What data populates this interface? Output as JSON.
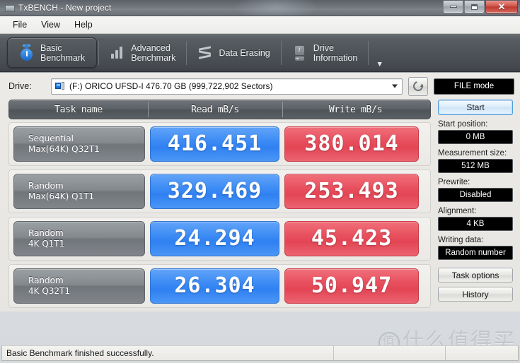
{
  "window": {
    "title": "TxBENCH - New project",
    "app_icon": "monitor-icon",
    "minimize_label": "–",
    "maximize_label": "❐",
    "close_label": "✕"
  },
  "menu": {
    "items": [
      {
        "label": "File"
      },
      {
        "label": "View"
      },
      {
        "label": "Help"
      }
    ]
  },
  "tabs": [
    {
      "label_line1": "Basic",
      "label_line2": "Benchmark",
      "icon": "stopwatch-icon",
      "selected": true
    },
    {
      "label_line1": "Advanced",
      "label_line2": "Benchmark",
      "icon": "bar-chart-icon",
      "selected": false
    },
    {
      "label_line1": "Data Erasing",
      "label_line2": "",
      "icon": "shredder-icon",
      "selected": false
    },
    {
      "label_line1": "Drive",
      "label_line2": "Information",
      "icon": "drive-info-icon",
      "selected": false
    }
  ],
  "tab_overflow_icon": "chevron-down-icon",
  "drive": {
    "label": "Drive:",
    "selected": "(F:) ORICO UFSD-I  476.70 GB (999,722,902 Sectors)",
    "icon": "drive-icon",
    "dropdown_icon": "chevron-down-icon",
    "refresh_icon": "refresh-icon",
    "mode_indicator": "FILE mode"
  },
  "table": {
    "headers": [
      "Task name",
      "Read mB/s",
      "Write mB/s"
    ],
    "rows": [
      {
        "name_line1": "Sequential",
        "name_line2": "Max(64K) Q32T1",
        "read": "416.451",
        "write": "380.014"
      },
      {
        "name_line1": "Random",
        "name_line2": "Max(64K) Q1T1",
        "read": "329.469",
        "write": "253.493"
      },
      {
        "name_line1": "Random",
        "name_line2": "4K Q1T1",
        "read": "24.294",
        "write": "45.423"
      },
      {
        "name_line1": "Random",
        "name_line2": "4K Q32T1",
        "read": "26.304",
        "write": "50.947"
      }
    ]
  },
  "chart_data": {
    "type": "bar",
    "title": "TxBENCH Basic Benchmark Results",
    "categories": [
      "Sequential Max(64K) Q32T1",
      "Random Max(64K) Q1T1",
      "Random 4K Q1T1",
      "Random 4K Q32T1"
    ],
    "series": [
      {
        "name": "Read mB/s",
        "values": [
          416.451,
          329.469,
          24.294,
          26.304
        ],
        "color": "#3d8cf5"
      },
      {
        "name": "Write mB/s",
        "values": [
          380.014,
          253.493,
          45.423,
          50.947
        ],
        "color": "#e8505e"
      }
    ],
    "xlabel": "Task name",
    "ylabel": "mB/s",
    "legend": [
      "Read mB/s",
      "Write mB/s"
    ]
  },
  "side": {
    "start_button": "Start",
    "fields": [
      {
        "label": "Start position:",
        "value": "0 MB"
      },
      {
        "label": "Measurement size:",
        "value": "512 MB"
      },
      {
        "label": "Prewrite:",
        "value": "Disabled"
      },
      {
        "label": "Alignment:",
        "value": "4 KB"
      },
      {
        "label": "Writing data:",
        "value": "Random number"
      }
    ],
    "task_options_button": "Task options",
    "history_button": "History"
  },
  "statusbar": {
    "message": "Basic Benchmark finished successfully.",
    "pane2": "",
    "pane3": ""
  },
  "watermark": {
    "mark": "值",
    "text": "什么值得买"
  },
  "colors": {
    "read_chip": "#3d8cf5",
    "write_chip": "#e8505e",
    "toolbar_dark": "#4e5358",
    "value_box_bg": "#000000",
    "accent_start": "#4f9ddb"
  }
}
